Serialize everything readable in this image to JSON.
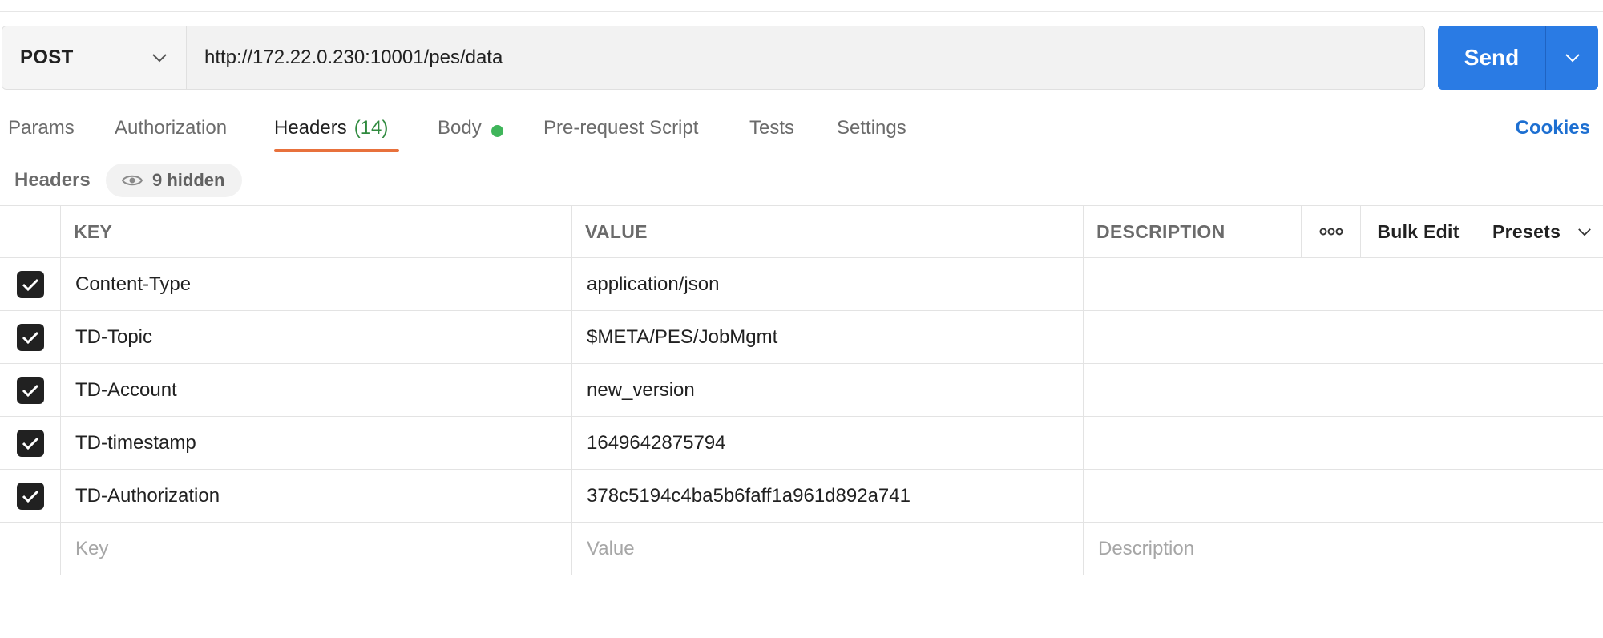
{
  "request": {
    "method": "POST",
    "url": "http://172.22.0.230:10001/pes/data",
    "send_label": "Send"
  },
  "tabs": [
    {
      "label": "Params"
    },
    {
      "label": "Authorization"
    },
    {
      "label": "Headers",
      "count": "(14)"
    },
    {
      "label": "Body"
    },
    {
      "label": "Pre-request Script"
    },
    {
      "label": "Tests"
    },
    {
      "label": "Settings"
    }
  ],
  "cookies_label": "Cookies",
  "headers_section": {
    "title": "Headers",
    "hidden_label": "9 hidden"
  },
  "table": {
    "columns": {
      "key": "KEY",
      "value": "VALUE",
      "description": "DESCRIPTION"
    },
    "bulk_edit_label": "Bulk Edit",
    "presets_label": "Presets",
    "rows": [
      {
        "key": "Content-Type",
        "value": "application/json",
        "description": ""
      },
      {
        "key": "TD-Topic",
        "value": "$META/PES/JobMgmt",
        "description": ""
      },
      {
        "key": "TD-Account",
        "value": "new_version",
        "description": ""
      },
      {
        "key": "TD-timestamp",
        "value": "1649642875794",
        "description": ""
      },
      {
        "key": "TD-Authorization",
        "value": "378c5194c4ba5b6faff1a961d892a741",
        "description": ""
      }
    ],
    "new_row": {
      "key_placeholder": "Key",
      "value_placeholder": "Value",
      "description_placeholder": "Description"
    }
  },
  "colors": {
    "send": "#2a7be4",
    "active_tab_underline": "#e8713c",
    "headers_count": "#2f8a3e",
    "body_dot": "#3fb55a",
    "cookies_link": "#1d6fd1"
  }
}
